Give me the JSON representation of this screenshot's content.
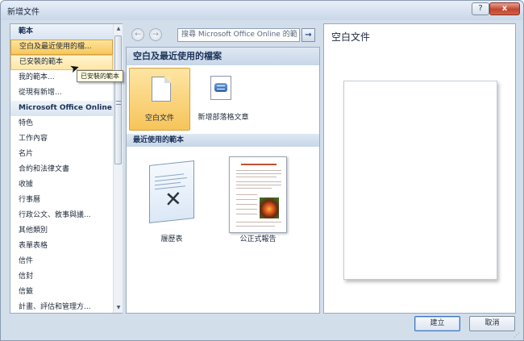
{
  "window": {
    "title": "新增文件",
    "help_label": "?",
    "close_label": "x"
  },
  "left_panel": {
    "items": [
      {
        "label": "範本",
        "kind": "header"
      },
      {
        "label": "空白及最近使用的檔...",
        "kind": "selected"
      },
      {
        "label": "已安裝的範本",
        "kind": "hover"
      },
      {
        "label": "我的範本...",
        "kind": "normal"
      },
      {
        "label": "從現有新增...",
        "kind": "normal"
      },
      {
        "label": "Microsoft Office Online",
        "kind": "header"
      },
      {
        "label": "特色",
        "kind": "normal"
      },
      {
        "label": "工作內容",
        "kind": "normal"
      },
      {
        "label": "名片",
        "kind": "normal"
      },
      {
        "label": "合約和法律文書",
        "kind": "normal"
      },
      {
        "label": "收據",
        "kind": "normal"
      },
      {
        "label": "行事曆",
        "kind": "normal"
      },
      {
        "label": "行政公文、敘事與議...",
        "kind": "normal"
      },
      {
        "label": "其他類別",
        "kind": "normal"
      },
      {
        "label": "表單表格",
        "kind": "normal"
      },
      {
        "label": "信件",
        "kind": "normal"
      },
      {
        "label": "信封",
        "kind": "normal"
      },
      {
        "label": "信籤",
        "kind": "normal"
      },
      {
        "label": "計畫、評估和管理方...",
        "kind": "normal"
      }
    ],
    "tooltip": "已安裝的範本"
  },
  "search": {
    "back_label": "←",
    "forward_label": "→",
    "text": "搜尋 Microsoft Office Online 的範",
    "go_label": "→"
  },
  "middle_panel": {
    "section_title": "空白及最近使用的檔案",
    "blank_doc_label": "空白文件",
    "blog_label": "新增部落格文章",
    "recent_title": "最近使用的範本",
    "resume_label": "履歷表",
    "report_label": "公正式報告"
  },
  "preview": {
    "title": "空白文件"
  },
  "buttons": {
    "create_label": "建立",
    "cancel_label": "取消"
  }
}
